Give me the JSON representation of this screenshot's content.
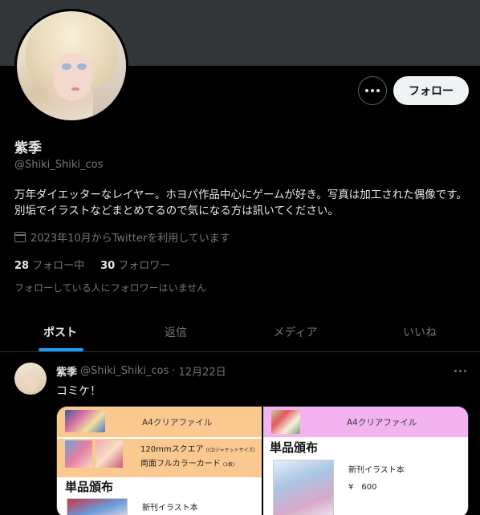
{
  "profile": {
    "name": "紫季",
    "handle": "@Shiki_Shiki_cos",
    "bio": "万年ダイエッターなレイヤー。ホヨパ作品中心にゲームが好き。写真は加工された偶像です。別垢でイラストなどまとめてるので気になる方は訊いてください。",
    "joined": "2023年10月からTwitterを利用しています",
    "following_count": "28",
    "following_label": "フォロー中",
    "followers_count": "30",
    "followers_label": "フォロワー",
    "no_followers_note": "フォローしている人にフォロワーはいません"
  },
  "actions": {
    "follow_label": "フォロー"
  },
  "tabs": [
    {
      "label": "ポスト"
    },
    {
      "label": "返信"
    },
    {
      "label": "メディア"
    },
    {
      "label": "いいね"
    }
  ],
  "post": {
    "name": "紫季",
    "handle": "@Shiki_Shiki_cos",
    "separator": "·",
    "date": "12月22日",
    "text": "コミケ！",
    "media": {
      "left": {
        "header": "A4クリアファイル",
        "line1": "120mmスクエア",
        "line1_note": "(CDジャケットサイズ)",
        "line2": "両面フルカラーカード",
        "line2_note": "(1枚)",
        "section": "単品頒布",
        "item": "新刊イラスト本"
      },
      "right": {
        "header": "A4クリアファイル",
        "section": "単品頒布",
        "item": "新刊イラスト本",
        "price": "¥　600"
      }
    }
  },
  "colors": {
    "accent": "#1d9bf0",
    "banner": "#333639",
    "left_panel": "#fbc98f",
    "right_panel": "#f2b3f0"
  }
}
